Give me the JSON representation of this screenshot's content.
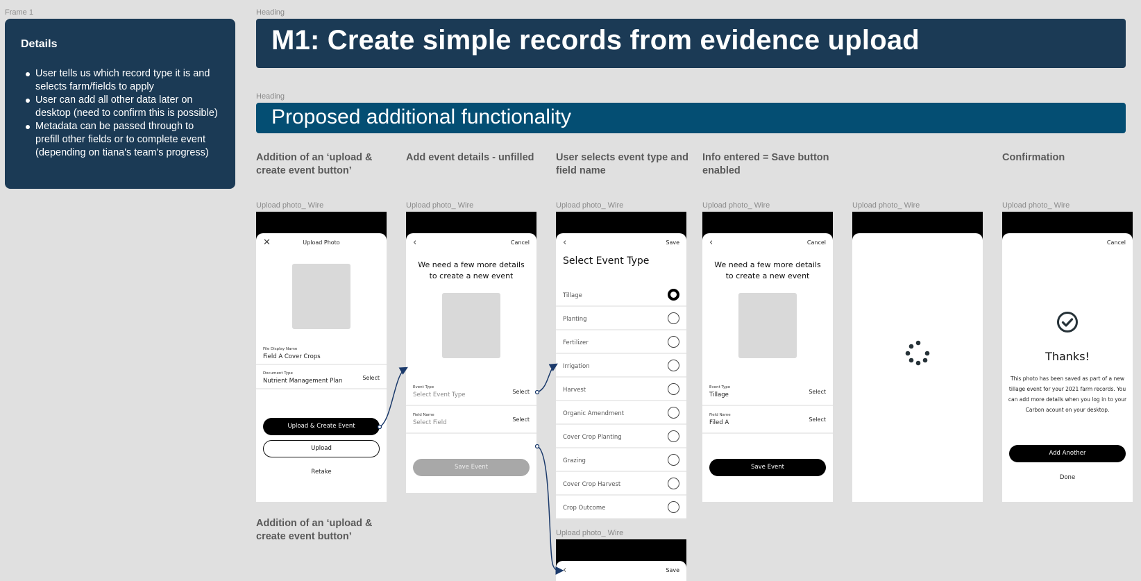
{
  "frame_label": "Frame 1",
  "details": {
    "title": "Details",
    "bullets": [
      "User tells us which record type it is and selects farm/fields to apply",
      "User can add all other data later on desktop (need to confirm this is possible)",
      "Metadata can be passed through to prefill other fields or to complete event (depending on tiana's team's progress)"
    ]
  },
  "heading_label": "Heading",
  "heading_main": "M1: Create simple records from evidence upload",
  "heading_sub": "Proposed additional functionality",
  "colors": {
    "heading_dark": "#1b3a55",
    "heading_blue": "#044e73",
    "connector": "#1b3a6b"
  },
  "columns": [
    {
      "title": "Addition of an ‘upload & create event button’"
    },
    {
      "title": "Add event details - unfilled"
    },
    {
      "title": "User selects event type and field name"
    },
    {
      "title": "Info entered = Save button enabled"
    },
    {
      "title": ""
    },
    {
      "title": "Confirmation"
    }
  ],
  "bottom_note": "Addition of an ‘upload & create event button’",
  "wire_label": "Upload photo_ Wire",
  "screens": {
    "upload": {
      "close_icon": "close-icon",
      "title": "Upload Photo",
      "file_label": "File Display Name",
      "file_value": "Field A Cover Crops",
      "doc_label": "Document Type",
      "doc_value": "Nutrient Management Plan",
      "doc_select": "Select",
      "primary_button": "Upload & Create Event",
      "secondary_button": "Upload",
      "retake": "Retake"
    },
    "details_unfilled": {
      "back_icon": "chevron-left-icon",
      "cancel": "Cancel",
      "prompt_line1": "We need a few more details",
      "prompt_line2": "to create a new event",
      "event_label": "Event Type",
      "event_placeholder": "Select Event Type",
      "event_select": "Select",
      "field_label": "Field Name",
      "field_placeholder": "Select Field",
      "field_select": "Select",
      "save_button": "Save Event"
    },
    "event_type": {
      "back_icon": "chevron-left-icon",
      "save": "Save",
      "title": "Select Event Type",
      "options": [
        {
          "label": "Tillage",
          "selected": true
        },
        {
          "label": "Planting",
          "selected": false
        },
        {
          "label": "Fertilizer",
          "selected": false
        },
        {
          "label": "Irrigation",
          "selected": false
        },
        {
          "label": "Harvest",
          "selected": false
        },
        {
          "label": "Organic Amendment",
          "selected": false
        },
        {
          "label": "Cover Crop Planting",
          "selected": false
        },
        {
          "label": "Grazing",
          "selected": false
        },
        {
          "label": "Cover Crop Harvest",
          "selected": false
        },
        {
          "label": "Crop Outcome",
          "selected": false
        }
      ]
    },
    "details_filled": {
      "back_icon": "chevron-left-icon",
      "cancel": "Cancel",
      "prompt_line1": "We need a few more details",
      "prompt_line2": "to create a new event",
      "event_label": "Event Type",
      "event_value": "Tillage",
      "event_select": "Select",
      "field_label": "Field Name",
      "field_value": "Filed A",
      "field_select": "Select",
      "save_button": "Save Event"
    },
    "loading": {
      "spinner_icon": "loading-spinner-icon"
    },
    "confirmation": {
      "cancel": "Cancel",
      "check_icon": "check-circle-icon",
      "title": "Thanks!",
      "body": "This photo has been saved as part of a new tillage event for your 2021 farm records. You can add more details when you log in to your Carbon acount on your desktop.",
      "primary_button": "Add Another",
      "done": "Done"
    },
    "field_select": {
      "back_icon": "chevron-left-icon",
      "save": "Save"
    }
  }
}
